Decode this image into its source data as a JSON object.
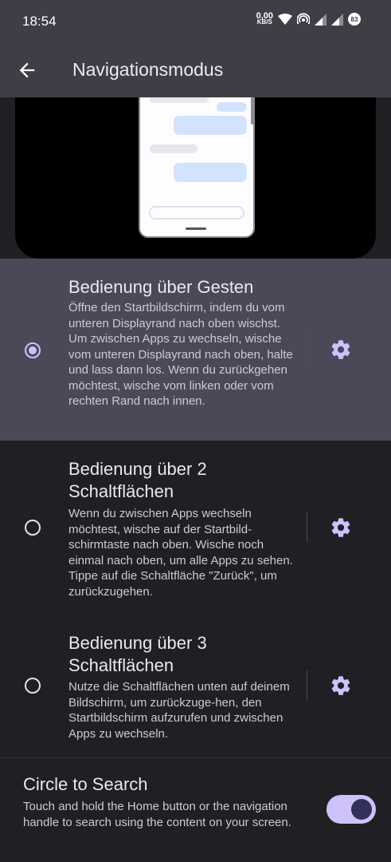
{
  "status_bar": {
    "time": "18:54",
    "net_speed_value": "0,00",
    "net_speed_unit": "KB/S",
    "battery": "83",
    "icons": [
      "wifi-icon",
      "hotspot-icon",
      "signal-icon",
      "signal-icon"
    ]
  },
  "app_bar": {
    "title": "Navigationsmodus",
    "back_icon": "arrow-back-icon"
  },
  "options": [
    {
      "title": "Bedienung über Gesten",
      "description": "Öffne den Startbildschirm, indem du vom unteren Displayrand nach oben wischst. Um zwischen Apps zu wechseln, wische vom unteren Displayrand nach oben, halte und lass dann los. Wenn du zurückgehen möchtest, wische vom linken oder vom rechten Rand nach innen.",
      "selected": true
    },
    {
      "title": "Bedienung über 2 Schaltflächen",
      "description": "Wenn du zwischen Apps wechseln möchtest, wische auf der Startbild-schirmtaste nach oben. Wische noch einmal nach oben, um alle Apps zu sehen. Tippe auf die Schaltfläche \"Zurück\", um zurückzugehen.",
      "selected": false
    },
    {
      "title": "Bedienung über 3 Schaltflächen",
      "description": "Nutze die Schaltflächen unten auf deinem Bildschirm, um zurückzuge-hen, den Startbildschirm aufzurufen und zwischen Apps zu wechseln.",
      "selected": false
    }
  ],
  "circle_to_search": {
    "title": "Circle to Search",
    "description": "Touch and hold the Home button or the navigation handle to search using the content on your screen.",
    "enabled": true
  },
  "colors": {
    "accent": "#cfc2fa",
    "selected_row": "#4b4958",
    "background": "#201f24",
    "app_bar": "#3f3d46"
  }
}
